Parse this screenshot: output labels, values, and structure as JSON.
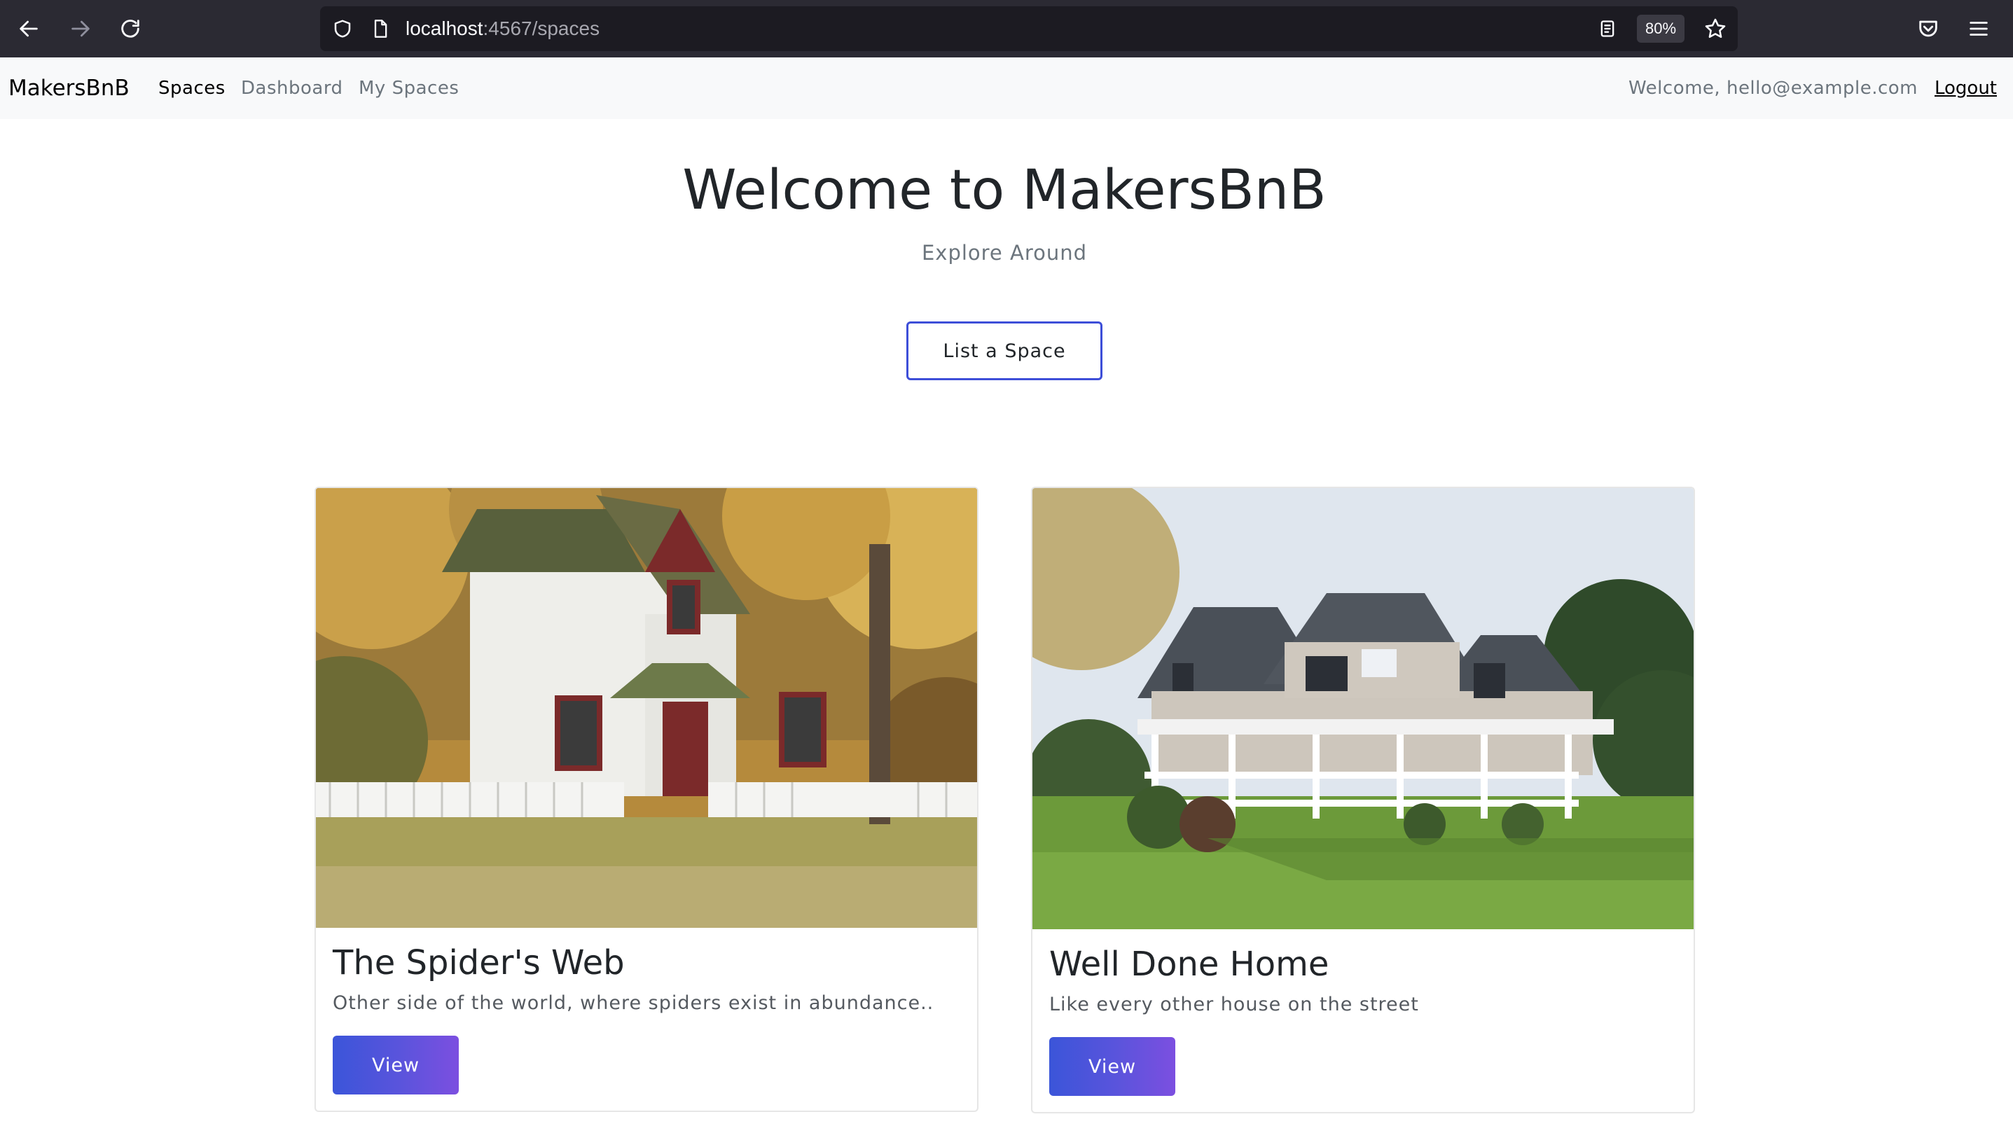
{
  "browser": {
    "url_host": "localhost",
    "url_path": ":4567/spaces",
    "zoom": "80%"
  },
  "navbar": {
    "brand": "MakersBnB",
    "links": [
      {
        "label": "Spaces",
        "active": true
      },
      {
        "label": "Dashboard",
        "active": false
      },
      {
        "label": "My Spaces",
        "active": false
      }
    ],
    "welcome": "Welcome, hello@example.com",
    "logout": "Logout"
  },
  "hero": {
    "title": "Welcome to MakersBnB",
    "subtitle": "Explore Around",
    "cta": "List a Space"
  },
  "spaces": [
    {
      "title": "The Spider's Web",
      "description": "Other side of the world, where spiders exist in abundance..",
      "button": "View"
    },
    {
      "title": "Well Done Home",
      "description": "Like every other house on the street",
      "button": "View"
    }
  ],
  "colors": {
    "chrome": "#2b2a33",
    "urlbar": "#1c1b22",
    "navbar_bg": "#f8f9fa",
    "accent": "#3d4ed8",
    "button_gradient_start": "#3b55d9",
    "button_gradient_end": "#7c4fe0"
  }
}
